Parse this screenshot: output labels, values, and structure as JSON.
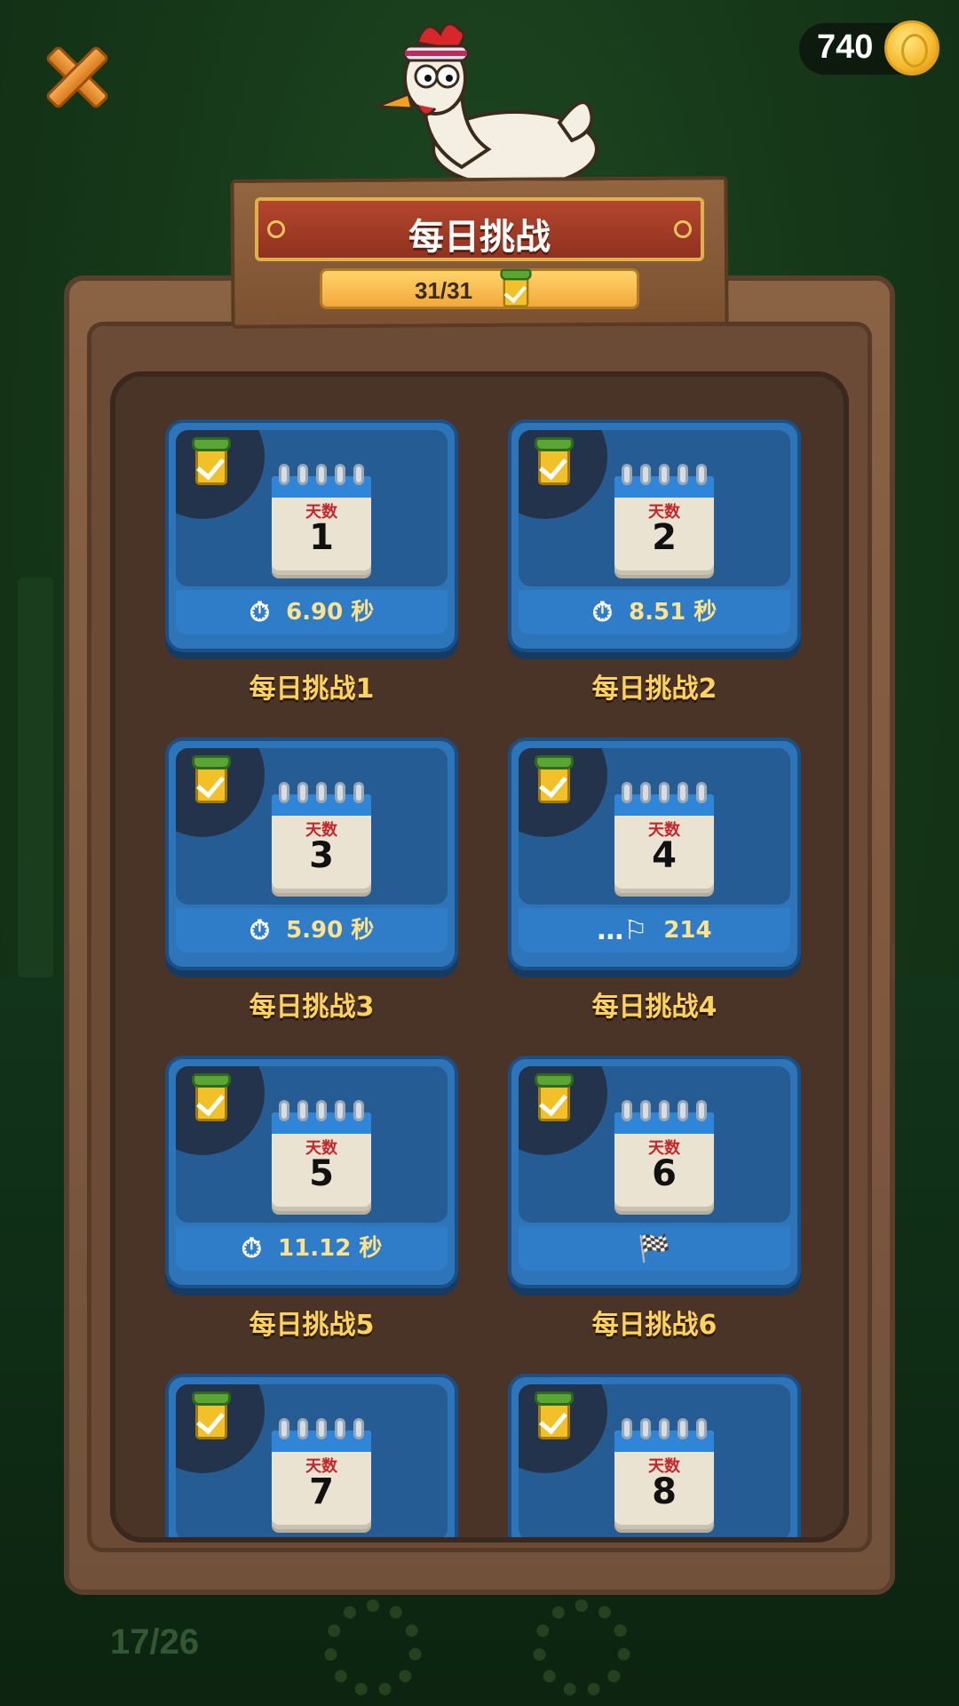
{
  "coins": {
    "value": "740"
  },
  "header": {
    "title": "每日挑战",
    "progress": "31/31"
  },
  "calendar_label": "天数",
  "cards": [
    {
      "day": "1",
      "stat_icon": "stopwatch-icon",
      "stat": "6.90 秒",
      "label": "每日挑战1"
    },
    {
      "day": "2",
      "stat_icon": "stopwatch-icon",
      "stat": "8.51 秒",
      "label": "每日挑战2"
    },
    {
      "day": "3",
      "stat_icon": "stopwatch-icon",
      "stat": "5.90 秒",
      "label": "每日挑战3"
    },
    {
      "day": "4",
      "stat_icon": "distance-flag-icon",
      "stat": "214",
      "label": "每日挑战4"
    },
    {
      "day": "5",
      "stat_icon": "stopwatch-icon",
      "stat": "11.12 秒",
      "label": "每日挑战5"
    },
    {
      "day": "6",
      "stat_icon": "checkered-flag-icon",
      "stat": "",
      "label": "每日挑战6"
    },
    {
      "day": "7"
    },
    {
      "day": "8"
    }
  ],
  "background": {
    "level_progress": "17/26"
  },
  "colors": {
    "card_blue": "#2d74b8",
    "label_gold": "#ffd35a",
    "ribbon_red": "#b5462e"
  }
}
